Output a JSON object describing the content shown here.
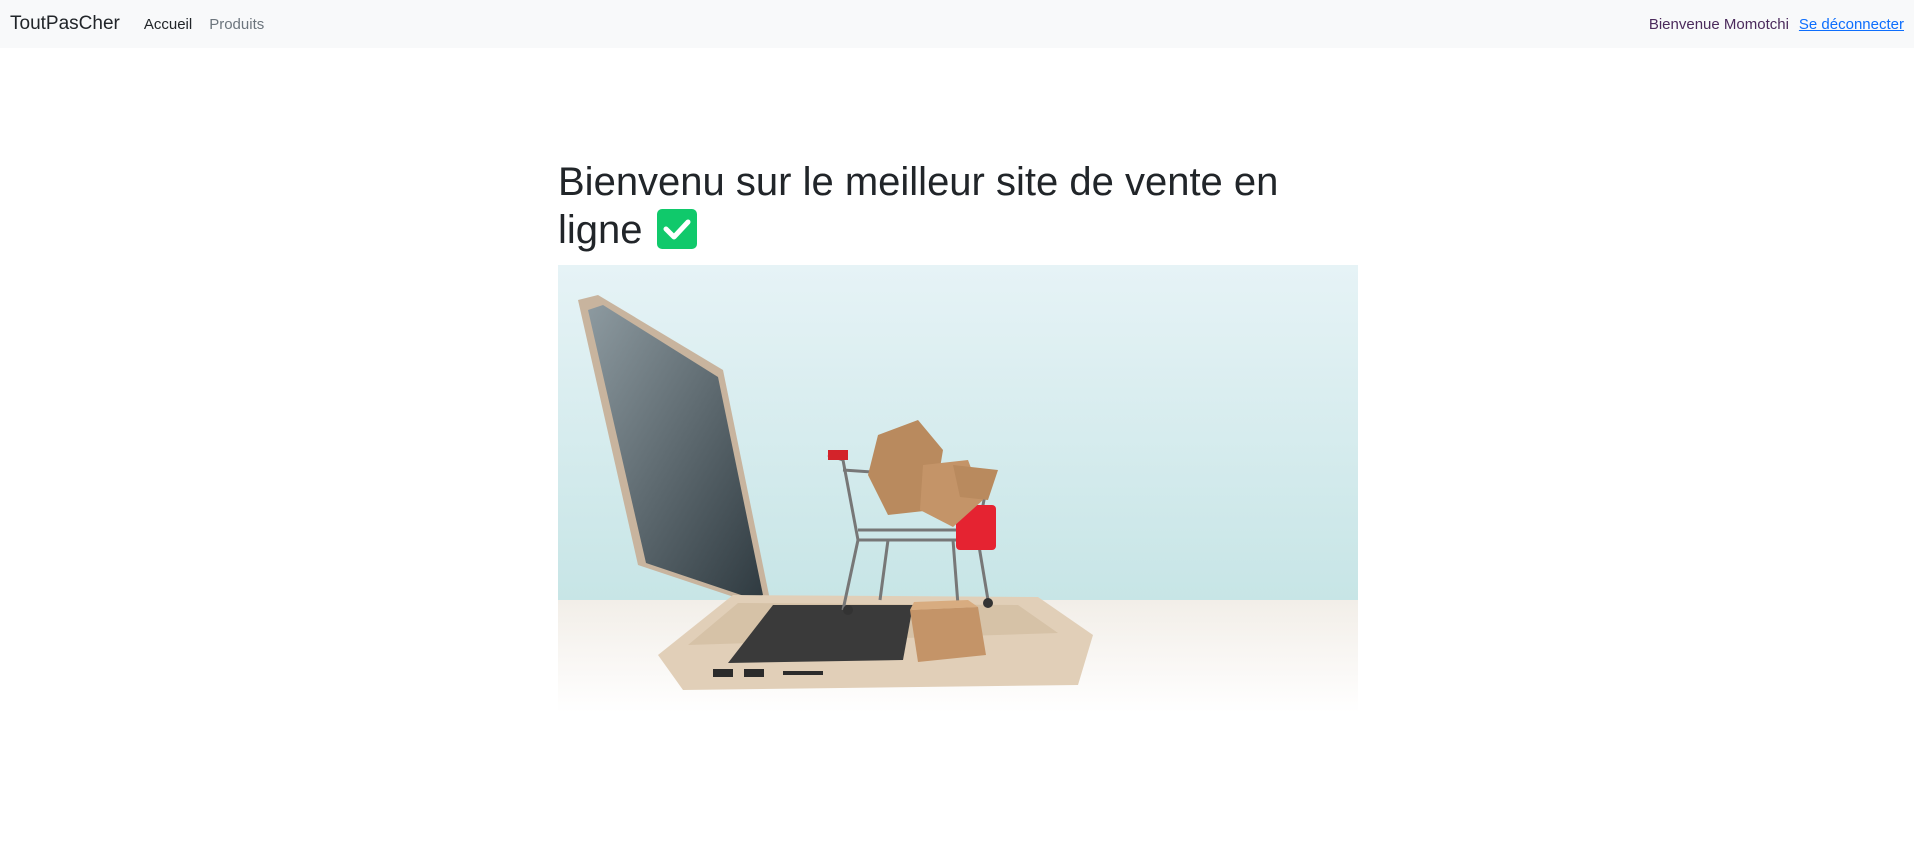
{
  "navbar": {
    "brand": "ToutPasCher",
    "links": [
      {
        "label": "Accueil"
      },
      {
        "label": "Produits"
      }
    ],
    "welcome_text": "Bienvenue Momotchi",
    "logout_label": "Se déconnecter"
  },
  "main": {
    "title": "Bienvenu sur le meilleur site de vente en ligne"
  },
  "icons": {
    "title_icon": "check-mark-button-icon"
  },
  "colors": {
    "navbar_bg": "#f8f9fa",
    "link": "#0d6efd",
    "check_green": "#10c96b"
  }
}
